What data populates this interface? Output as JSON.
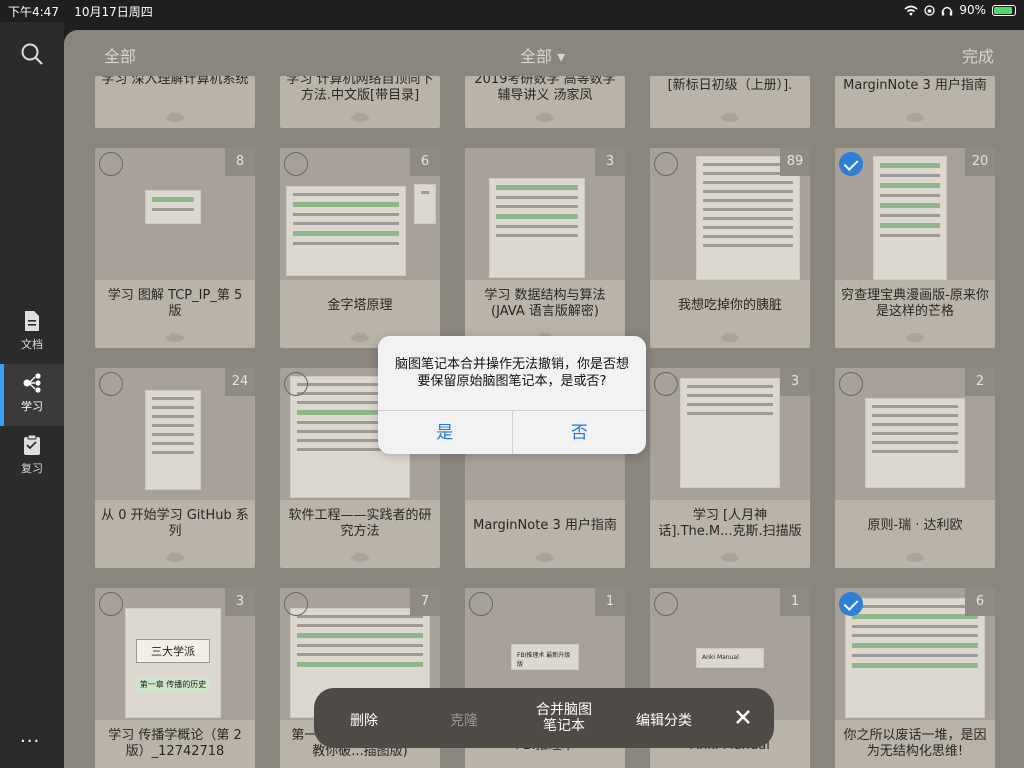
{
  "status": {
    "time": "下午4:47",
    "date": "10月17日周四",
    "battery": "90%",
    "battery_level": 0.9
  },
  "sidebar": {
    "items": [
      {
        "label": "文档"
      },
      {
        "label": "学习"
      },
      {
        "label": "复习"
      }
    ],
    "more": "···"
  },
  "topbar": {
    "left": "全部",
    "center": "全部 ▾",
    "right": "完成"
  },
  "top_row": [
    "学习 深入理解计算机系统",
    "学习 计算机网络自顶向下方法.中文版[带目录]",
    "2019考研数学 高等数学辅导讲义 汤家凤",
    "[新标日初级（上册）].",
    "MarginNote 3 用户指南"
  ],
  "row2": [
    {
      "title": "学习 图解 TCP_IP_第 5 版",
      "count": "8"
    },
    {
      "title": "金字塔原理",
      "count": "6"
    },
    {
      "title": "学习 数据结构与算法 (JAVA 语言版解密)",
      "count": "3"
    },
    {
      "title": "我想吃掉你的胰脏",
      "count": "89"
    },
    {
      "title": "穷查理宝典漫画版-原来你是这样的芒格",
      "count": "20"
    }
  ],
  "row3": [
    {
      "title": "从 0 开始学习 GitHub 系列",
      "count": "24"
    },
    {
      "title": "软件工程——实践者的研究方法",
      "count": ""
    },
    {
      "title": "MarginNote 3 用户指南",
      "count": ""
    },
    {
      "title": "学习 [人月神话].The.M...克斯.扫描版",
      "count": "3"
    },
    {
      "title": "原则-瑞 · 达利欧",
      "count": "2"
    }
  ],
  "row4": [
    {
      "title": "学习 传播学概论（第 2 版）_12742718",
      "count": "3"
    },
    {
      "title": "第一时间看透对方：FBI 教你破...插图版)",
      "count": "7"
    },
    {
      "title": "FBI推理术",
      "count": "1"
    },
    {
      "title": "Anki Manual",
      "count": "1"
    },
    {
      "title": "你之所以废话一堆，是因为无结构化思维!",
      "count": "6"
    }
  ],
  "thumb_text": {
    "r2c3": "FBI推理术 最新升级版",
    "r2c4": "Anki Manual",
    "r3c1": "三大学派",
    "r3c1b": "第一章 传播的历史"
  },
  "dialog": {
    "message": "脑图笔记本合并操作无法撤销，你是否想要保留原始脑图笔记本，是或否?",
    "yes": "是",
    "no": "否"
  },
  "toolbar": {
    "delete": "删除",
    "clone": "克隆",
    "merge": "合并脑图笔记本",
    "edit_category": "编辑分类"
  },
  "colors": {
    "accent": "#2f7fd6",
    "dialog_button": "#1a7ae0"
  }
}
